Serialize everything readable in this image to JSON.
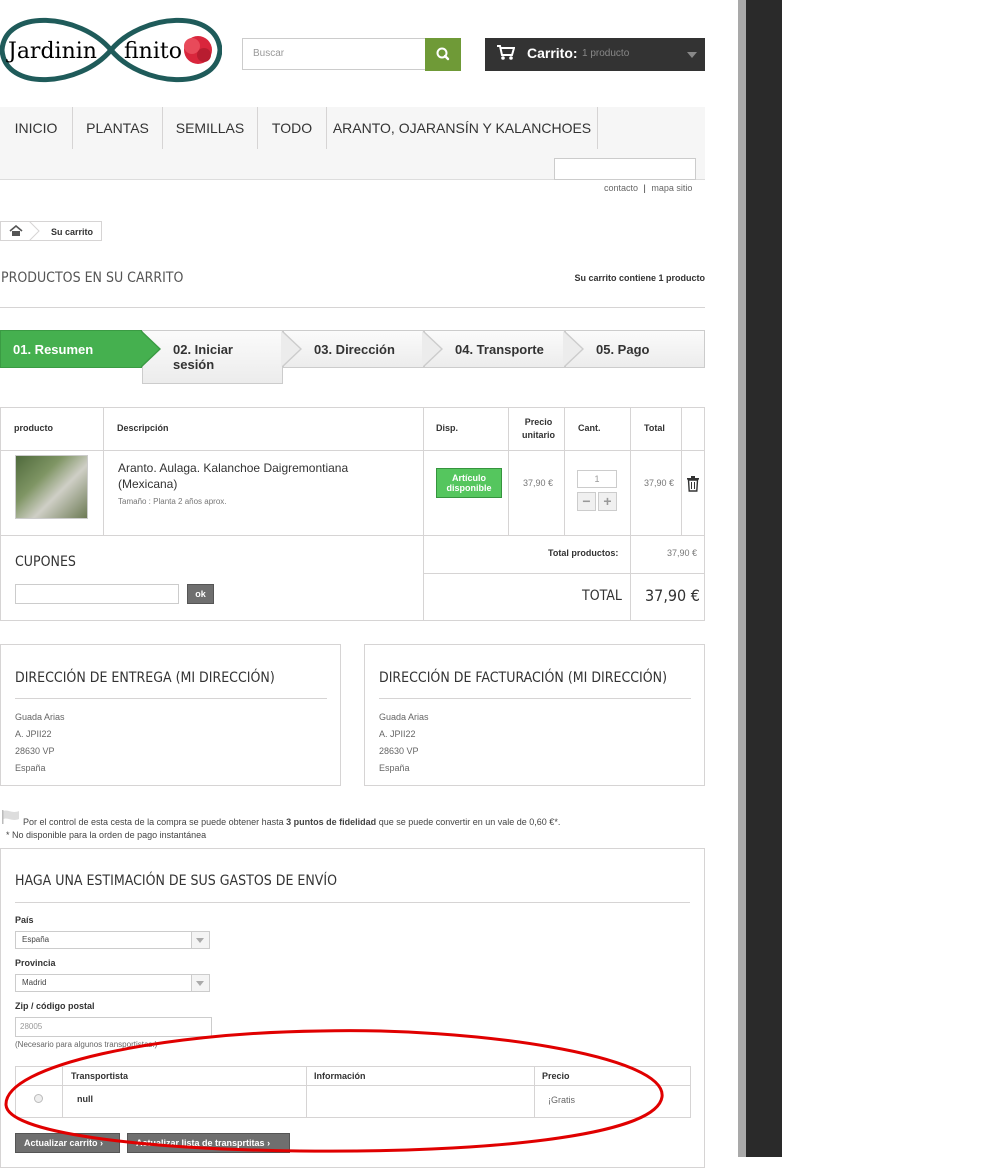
{
  "logo": {
    "part1": "Jardinin",
    "part2": "finito"
  },
  "search": {
    "placeholder": "Buscar"
  },
  "cart": {
    "label": "Carrito:",
    "count": "1 producto"
  },
  "nav": {
    "items": [
      "INICIO",
      "PLANTAS",
      "SEMILLAS",
      "TODO",
      "ARANTO, OJARANSÍN Y KALANCHOES"
    ]
  },
  "top_links": {
    "contact": "contacto",
    "separator": "|",
    "sitemap": "mapa sitio"
  },
  "breadcrumb": {
    "current": "Su carrito"
  },
  "page": {
    "title": "PRODUCTOS EN SU CARRITO",
    "cart_contains": "Su carrito contiene 1 producto"
  },
  "steps": [
    {
      "line1": "01. Resumen",
      "line2": ""
    },
    {
      "line1": "02. Iniciar",
      "line2": "sesión"
    },
    {
      "line1": "03. Dirección",
      "line2": ""
    },
    {
      "line1": "04. Transporte",
      "line2": ""
    },
    {
      "line1": "05. Pago",
      "line2": ""
    }
  ],
  "table": {
    "headers": {
      "product": "producto",
      "description": "Descripción",
      "availability": "Disp.",
      "unit_price_1": "Precio",
      "unit_price_2": "unitario",
      "qty": "Cant.",
      "total": "Total"
    },
    "row": {
      "name": "Aranto. Aulaga. Kalanchoe Daigremontiana (Mexicana)",
      "attributes": "Tamaño : Planta 2 años aprox.",
      "availability_1": "Artículo",
      "availability_2": "disponible",
      "unit_price": "37,90 €",
      "quantity": "1",
      "minus": "−",
      "plus": "+",
      "total": "37,90 €"
    },
    "subtotal_label": "Total productos:",
    "subtotal_value": "37,90 €",
    "total_label": "TOTAL",
    "total_value": "37,90 €"
  },
  "coupons": {
    "title": "CUPONES",
    "button": "ok"
  },
  "delivery_address": {
    "title": "DIRECCIÓN DE ENTREGA (MI DIRECCIÓN)",
    "lines": [
      "Guada Arias",
      "A. JPII22",
      "28630 VP",
      "España"
    ]
  },
  "invoice_address": {
    "title": "DIRECCIÓN DE FACTURACIÓN (MI DIRECCIÓN)",
    "lines": [
      "Guada Arias",
      "A. JPII22",
      "28630 VP",
      "España"
    ]
  },
  "loyalty": {
    "text_before": "Por el control de esta cesta de la compra se puede obtener hasta ",
    "points": "3 puntos de fidelidad",
    "text_after": " que se puede convertir en un vale de 0,60 €*.",
    "note": "* No disponible para la orden de pago instantánea"
  },
  "shipping": {
    "title": "HAGA UNA ESTIMACIÓN DE SUS GASTOS DE ENVÍO",
    "country_label": "País",
    "country_value": "España",
    "state_label": "Provincia",
    "state_value": "Madrid",
    "zip_label": "Zip / código postal",
    "zip_value": "28005",
    "zip_note": "(Necesario para algunos transportistas.)",
    "carrier_headers": {
      "carrier": "Transportista",
      "info": "Información",
      "price": "Precio"
    },
    "carrier_row": {
      "name": "null",
      "info": "",
      "price": "¡Gratis"
    },
    "update_cart_button": "Actualizar carrito",
    "update_carriers_button": "Actualizar lista de transprtitas"
  },
  "colors": {
    "accent_green": "#6f9a37",
    "step_active": "#45b04f",
    "annotation_red": "#e00000"
  }
}
